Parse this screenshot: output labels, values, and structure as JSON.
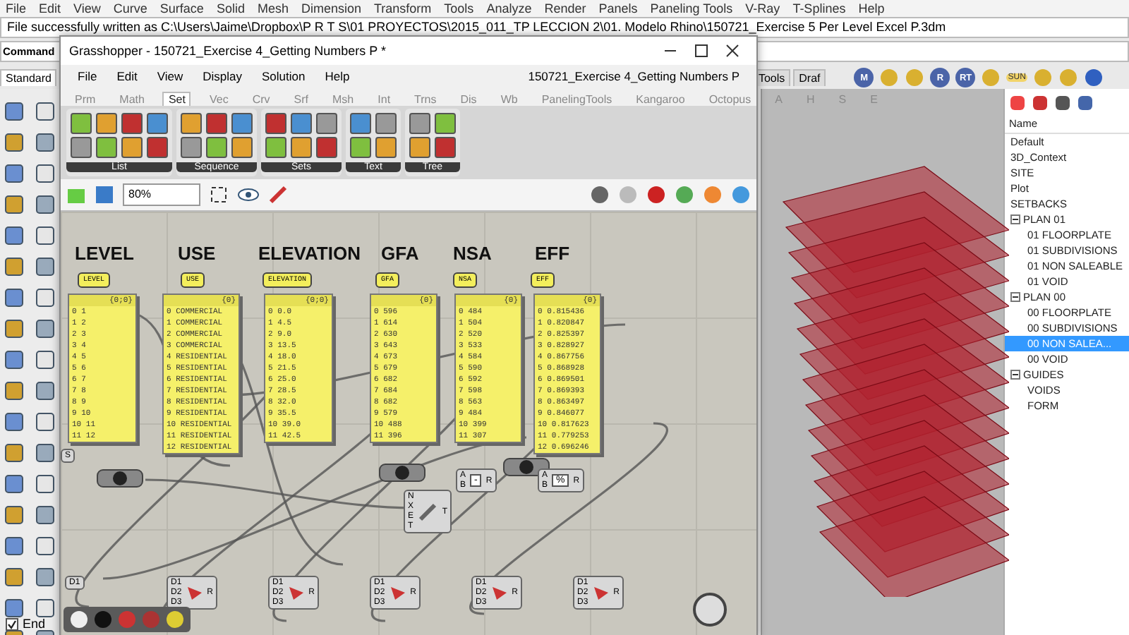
{
  "rhino_menu": [
    "File",
    "Edit",
    "View",
    "Curve",
    "Surface",
    "Solid",
    "Mesh",
    "Dimension",
    "Transform",
    "Tools",
    "Analyze",
    "Render",
    "Panels",
    "Paneling Tools",
    "V-Ray",
    "T-Splines",
    "Help"
  ],
  "status_line": "File successfully written as C:\\Users\\Jaime\\Dropbox\\P R T S\\01 PROYECTOS\\2015_011_TP LECCION 2\\01. Modelo Rhino\\150721_Exercise 5 Per Level Excel P.3dm",
  "command_label": "Command",
  "toolbar_tabs": [
    {
      "label": "Standard",
      "selected": true
    },
    {
      "label": "Tools",
      "selected": false
    },
    {
      "label": "Draf",
      "selected": false
    }
  ],
  "render_toolbar": [
    {
      "kind": "letter",
      "label": "M"
    },
    {
      "kind": "gear"
    },
    {
      "kind": "tag"
    },
    {
      "kind": "letter",
      "label": "R"
    },
    {
      "kind": "letter",
      "label": "RT"
    },
    {
      "kind": "bird"
    },
    {
      "kind": "sun",
      "label": "SUN"
    },
    {
      "kind": "lamp"
    },
    {
      "kind": "tree"
    },
    {
      "kind": "help"
    }
  ],
  "grasshopper": {
    "title": "Grasshopper - 150721_Exercise 4_Getting Numbers P *",
    "menu": [
      "File",
      "Edit",
      "View",
      "Display",
      "Solution",
      "Help"
    ],
    "document_name": "150721_Exercise 4_Getting Numbers P",
    "tabs": [
      {
        "label": "Prm",
        "selected": false
      },
      {
        "label": "Math",
        "selected": false
      },
      {
        "label": "Set",
        "selected": true
      },
      {
        "label": "Vec",
        "selected": false
      },
      {
        "label": "Crv",
        "selected": false
      },
      {
        "label": "Srf",
        "selected": false
      },
      {
        "label": "Msh",
        "selected": false
      },
      {
        "label": "Int",
        "selected": false
      },
      {
        "label": "Trns",
        "selected": false
      },
      {
        "label": "Dis",
        "selected": false
      },
      {
        "label": "Wb",
        "selected": false
      },
      {
        "label": "PanelingTools",
        "selected": false
      },
      {
        "label": "Kangaroo",
        "selected": false
      },
      {
        "label": "Octopus",
        "selected": false
      },
      {
        "label": "A",
        "selected": false
      },
      {
        "label": "H",
        "selected": false
      },
      {
        "label": "S",
        "selected": false
      },
      {
        "label": "E",
        "selected": false
      }
    ],
    "ribbon_groups": [
      {
        "label": "List"
      },
      {
        "label": "Sequence"
      },
      {
        "label": "Sets"
      },
      {
        "label": "Text"
      },
      {
        "label": "Tree"
      }
    ],
    "zoom": "80%",
    "columns": [
      {
        "title": "LEVEL",
        "param": "LEVEL",
        "header": "{0;0}",
        "rows": [
          "0 1",
          "1 2",
          "2 3",
          "3 4",
          "4 5",
          "5 6",
          "6 7",
          "7 8",
          "8 9",
          "9 10",
          "10 11",
          "11 12"
        ]
      },
      {
        "title": "USE",
        "param": "USE",
        "header": "{0}",
        "rows": [
          "0 COMMERCIAL",
          "1 COMMERCIAL",
          "2 COMMERCIAL",
          "3 COMMERCIAL",
          "4 RESIDENTIAL",
          "5 RESIDENTIAL",
          "6 RESIDENTIAL",
          "7 RESIDENTIAL",
          "8 RESIDENTIAL",
          "9 RESIDENTIAL",
          "10 RESIDENTIAL",
          "11 RESIDENTIAL",
          "12 RESIDENTIAL"
        ]
      },
      {
        "title": "ELEVATION",
        "param": "ELEVATION",
        "header": "{0;0}",
        "rows": [
          "0 0.0",
          "1 4.5",
          "2 9.0",
          "3 13.5",
          "4 18.0",
          "5 21.5",
          "6 25.0",
          "7 28.5",
          "8 32.0",
          "9 35.5",
          "10 39.0",
          "11 42.5"
        ]
      },
      {
        "title": "GFA",
        "param": "GFA",
        "header": "{0}",
        "rows": [
          "0 596",
          "1 614",
          "2 630",
          "3 643",
          "4 673",
          "5 679",
          "6 682",
          "7 684",
          "8 682",
          "9 579",
          "10 488",
          "11 396"
        ]
      },
      {
        "title": "NSA",
        "param": "NSA",
        "header": "{0}",
        "rows": [
          "0 484",
          "1 504",
          "2 520",
          "3 533",
          "4 584",
          "5 590",
          "6 592",
          "7 598",
          "8 563",
          "9 484",
          "10 399",
          "11 307"
        ]
      },
      {
        "title": "EFF",
        "param": "EFF",
        "header": "{0}",
        "rows": [
          "0 0.815436",
          "1 0.820847",
          "2 0.825397",
          "3 0.828927",
          "4 0.867756",
          "5 0.868928",
          "6 0.869501",
          "7 0.869393",
          "8 0.863497",
          "9 0.846077",
          "10 0.817623",
          "11 0.779253",
          "12 0.696246"
        ]
      }
    ],
    "left_param": "S",
    "math_nodes": [
      {
        "inputs": [
          "A",
          "B"
        ],
        "symbol": "-",
        "output": "R"
      },
      {
        "inputs": [
          "A",
          "B"
        ],
        "symbol": "%",
        "output": "R"
      }
    ],
    "range_node": {
      "inputs": [
        "N",
        "X",
        "E",
        "T"
      ],
      "output": "T"
    },
    "merge_nodes": [
      {
        "inputs": [
          "D1"
        ]
      },
      {
        "inputs": [
          "D1",
          "D2",
          "D3"
        ],
        "output": "R"
      },
      {
        "inputs": [
          "D1",
          "D2",
          "D3"
        ],
        "output": "R"
      },
      {
        "inputs": [
          "D1",
          "D2",
          "D3"
        ],
        "output": "R"
      },
      {
        "inputs": [
          "D1",
          "D2",
          "D3"
        ],
        "output": "R"
      },
      {
        "inputs": [
          "D1",
          "D2",
          "D3"
        ],
        "output": "R"
      }
    ]
  },
  "layers": {
    "header": "Name",
    "items": [
      {
        "label": "Default",
        "selected": false
      },
      {
        "label": "3D_Context",
        "selected": false
      },
      {
        "label": "SITE",
        "selected": false
      },
      {
        "label": "Plot",
        "selected": false
      },
      {
        "label": "SETBACKS",
        "selected": false
      },
      {
        "label": "PLAN 01",
        "selected": false,
        "expanded": true,
        "children": [
          {
            "label": "01 FLOORPLATE",
            "selected": false
          },
          {
            "label": "01 SUBDIVISIONS",
            "selected": false
          },
          {
            "label": "01 NON SALEABLE",
            "selected": false
          },
          {
            "label": "01 VOID",
            "selected": false
          }
        ]
      },
      {
        "label": "PLAN 00",
        "selected": false,
        "expanded": true,
        "children": [
          {
            "label": "00 FLOORPLATE",
            "selected": false
          },
          {
            "label": "00 SUBDIVISIONS",
            "selected": false
          },
          {
            "label": "00 NON SALEA...",
            "selected": true
          },
          {
            "label": "00 VOID",
            "selected": false
          }
        ]
      },
      {
        "label": "GUIDES",
        "selected": false,
        "expanded": true,
        "children": [
          {
            "label": "VOIDS",
            "selected": false
          },
          {
            "label": "FORM",
            "selected": false
          }
        ]
      }
    ]
  },
  "osnap": [
    {
      "label": "End",
      "checked": true
    }
  ]
}
